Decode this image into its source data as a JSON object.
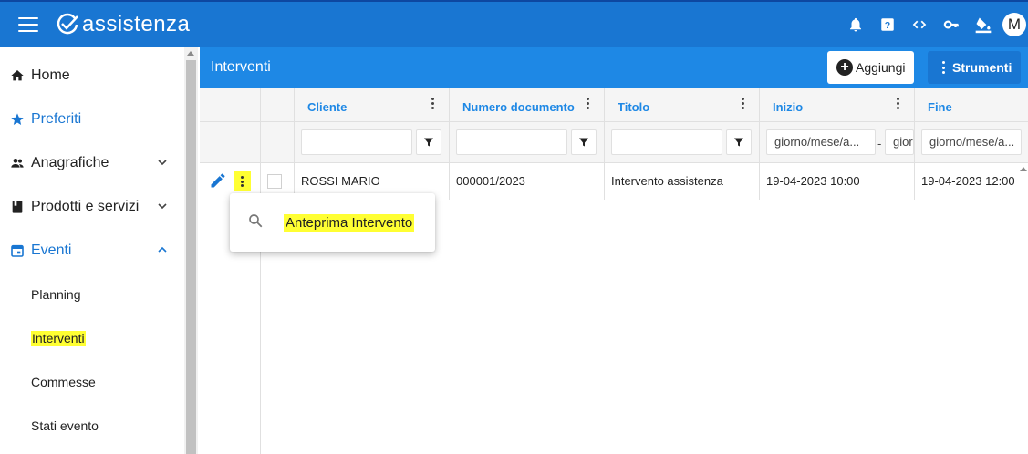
{
  "app": {
    "name": "assistenza",
    "user_initial": "M"
  },
  "topbar": {
    "icons": [
      "menu-icon",
      "bell-icon",
      "help-icon",
      "code-icon",
      "key-icon",
      "paint-bucket-icon"
    ]
  },
  "sidebar": {
    "items": [
      {
        "label": "Home",
        "icon": "home-icon"
      },
      {
        "label": "Preferiti",
        "icon": "star-icon"
      },
      {
        "label": "Anagrafiche",
        "icon": "people-icon"
      },
      {
        "label": "Prodotti e servizi",
        "icon": "book-icon"
      },
      {
        "label": "Eventi",
        "icon": "calendar-icon"
      }
    ],
    "sub_items": [
      "Planning",
      "Interventi",
      "Commesse",
      "Stati evento"
    ]
  },
  "main": {
    "title": "Interventi",
    "add_label": "Aggiungi",
    "tools_label": "Strumenti",
    "columns": [
      "Cliente",
      "Numero documento",
      "Titolo",
      "Inizio",
      "Fine"
    ],
    "date_placeholder": "giorno/mese/a...",
    "date_placeholder_short": "gior",
    "date_separator": "-"
  },
  "rows": [
    {
      "cliente": "ROSSI MARIO",
      "numero_documento": "000001/2023",
      "titolo": "Intervento assistenza",
      "inizio": "19-04-2023 10:00",
      "fine": "19-04-2023 12:00"
    }
  ],
  "context_menu": {
    "item_label": "Anteprima Intervento",
    "icon": "search-icon"
  },
  "colors": {
    "header_blue": "#1976d2",
    "title_blue": "#1e88e5",
    "highlight": "#ffff33"
  }
}
